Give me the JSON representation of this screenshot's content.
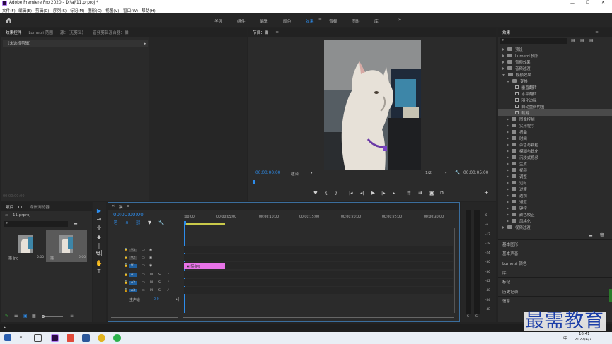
{
  "window": {
    "title": "Adobe Premiere Pro 2020 - D:\\aj\\11.prproj *",
    "controls": {
      "minimize": "—",
      "maximize": "☐",
      "close": "✕"
    }
  },
  "menu": [
    "文件(F)",
    "编辑(E)",
    "剪辑(C)",
    "序列(S)",
    "标记(M)",
    "图形(G)",
    "视图(V)",
    "窗口(W)",
    "帮助(H)"
  ],
  "workspaces": [
    {
      "label": "学习"
    },
    {
      "label": "组件"
    },
    {
      "label": "编辑"
    },
    {
      "label": "颜色"
    },
    {
      "label": "效果",
      "active": true
    },
    {
      "label": "音频"
    },
    {
      "label": "图形"
    },
    {
      "label": "库"
    }
  ],
  "workspace_more": "»",
  "source_panel": {
    "tabs": [
      "效果控件",
      "Lumetri 范围",
      "源：（无剪辑）",
      "音频剪辑混合器：猫"
    ],
    "no_clip": "（未选择剪辑）",
    "timecode": "00:00:00:00"
  },
  "program_monitor": {
    "tab": "节目：猫",
    "timecode": "00:00:00:00",
    "fit": "适合",
    "quality": "1/2",
    "duration": "00:00:05:00"
  },
  "project_panel": {
    "tabs": [
      "项目：11",
      "媒体浏览器"
    ],
    "file": "11.prproj",
    "items": [
      {
        "name": "猫.jpg",
        "duration": "5:00"
      },
      {
        "name": "猫",
        "duration": "5:00"
      }
    ]
  },
  "timeline": {
    "tab": "猫",
    "timecode": "00:00:00:00",
    "ruler": [
      ":00:00",
      "00:00:05:00",
      "00:00:10:00",
      "00:00:15:00",
      "00:00:20:00",
      "00:00:25:00",
      "00:00:30:00"
    ],
    "tracks": [
      {
        "name": "V3"
      },
      {
        "name": "V2"
      },
      {
        "name": "V1"
      },
      {
        "name": "A1"
      },
      {
        "name": "A2"
      },
      {
        "name": "A3"
      }
    ],
    "master": "主声道",
    "master_value": "0.0",
    "clip": "猫.jpg"
  },
  "meter": {
    "scale": [
      "0",
      "-6",
      "-12",
      "-18",
      "-24",
      "-30",
      "-36",
      "-42",
      "-48",
      "-54",
      "-dB"
    ],
    "channels": [
      "S",
      "S"
    ]
  },
  "effects_panel": {
    "tab": "效果",
    "tree": [
      {
        "label": "预设",
        "kind": "folder"
      },
      {
        "label": "Lumetri 预设",
        "kind": "folder"
      },
      {
        "label": "音频效果",
        "kind": "folder"
      },
      {
        "label": "音频过渡",
        "kind": "folder"
      },
      {
        "label": "视频效果",
        "kind": "folder",
        "open": true
      },
      {
        "label": "变换",
        "kind": "folder",
        "open": true,
        "indent": 1
      },
      {
        "label": "垂直翻转",
        "kind": "item",
        "indent": 2
      },
      {
        "label": "水平翻转",
        "kind": "item",
        "indent": 2
      },
      {
        "label": "羽化边缘",
        "kind": "item",
        "indent": 2
      },
      {
        "label": "自动重新构图",
        "kind": "item",
        "indent": 2
      },
      {
        "label": "裁剪",
        "kind": "item",
        "indent": 2,
        "selected": true
      },
      {
        "label": "图像控制",
        "kind": "folder",
        "indent": 1
      },
      {
        "label": "实用程序",
        "kind": "folder",
        "indent": 1
      },
      {
        "label": "扭曲",
        "kind": "folder",
        "indent": 1
      },
      {
        "label": "时间",
        "kind": "folder",
        "indent": 1
      },
      {
        "label": "杂色与颗粒",
        "kind": "folder",
        "indent": 1
      },
      {
        "label": "模糊与锐化",
        "kind": "folder",
        "indent": 1
      },
      {
        "label": "沉浸式视频",
        "kind": "folder",
        "indent": 1
      },
      {
        "label": "生成",
        "kind": "folder",
        "indent": 1
      },
      {
        "label": "视频",
        "kind": "folder",
        "indent": 1
      },
      {
        "label": "调整",
        "kind": "folder",
        "indent": 1
      },
      {
        "label": "过时",
        "kind": "folder",
        "indent": 1
      },
      {
        "label": "过渡",
        "kind": "folder",
        "indent": 1
      },
      {
        "label": "透视",
        "kind": "folder",
        "indent": 1
      },
      {
        "label": "通道",
        "kind": "folder",
        "indent": 1
      },
      {
        "label": "键控",
        "kind": "folder",
        "indent": 1
      },
      {
        "label": "颜色校正",
        "kind": "folder",
        "indent": 1
      },
      {
        "label": "风格化",
        "kind": "folder",
        "indent": 1
      },
      {
        "label": "视频过渡",
        "kind": "folder"
      }
    ],
    "bottom_panels": [
      "基本图形",
      "基本声音",
      "Lumetri 颜色",
      "库",
      "标记",
      "历史记录",
      "信息"
    ]
  },
  "taskbar": {
    "time": "16:41",
    "date": "2022/4/7",
    "ime": "中"
  },
  "watermark": "最需教育",
  "colors": {
    "accent": "#2d8ceb",
    "clip": "#e873e8",
    "panel": "#2b2b2b"
  }
}
